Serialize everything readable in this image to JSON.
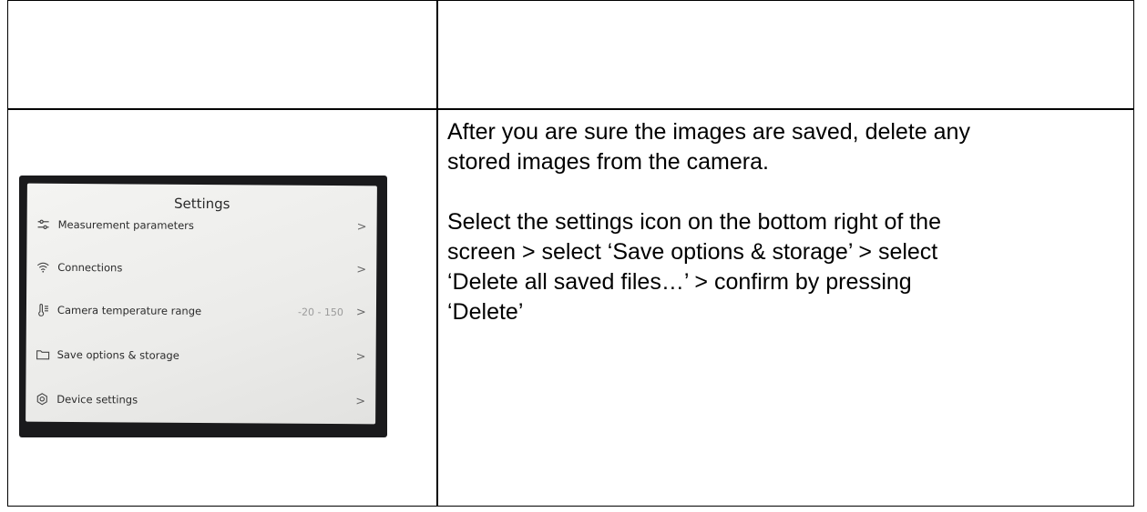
{
  "instructions": {
    "paragraph1": "After you are sure the images are saved, delete any\nstored images from the camera.",
    "paragraph2": "Select the settings icon on the bottom right of the\nscreen > select ‘Save options & storage’ > select\n‘Delete all saved files…’ > confirm by pressing\n‘Delete’"
  },
  "camera_screen": {
    "title": "Settings",
    "items": [
      {
        "icon": "sliders-icon",
        "label": "Measurement parameters",
        "value": "",
        "chevron": ">"
      },
      {
        "icon": "wifi-icon",
        "label": "Connections",
        "value": "",
        "chevron": ">"
      },
      {
        "icon": "thermometer-icon",
        "label": "Camera temperature range",
        "value": "-20 - 150",
        "chevron": ">"
      },
      {
        "icon": "folder-icon",
        "label": "Save options & storage",
        "value": "",
        "chevron": ">"
      },
      {
        "icon": "gear-icon",
        "label": "Device settings",
        "value": "",
        "chevron": ">"
      }
    ]
  }
}
